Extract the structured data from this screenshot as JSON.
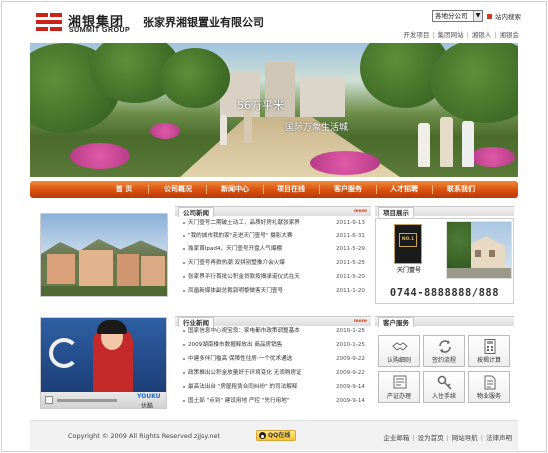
{
  "header": {
    "logo_cn": "湘银集团",
    "logo_en": "SUMMIT GROUP",
    "company_name": "张家界湘银置业有限公司",
    "branch_select": "各地分公司",
    "search_label": "站内搜索",
    "top_links": [
      "开发项目",
      "集团网站",
      "湘银人",
      "湘银会"
    ]
  },
  "banner": {
    "headline": "56万平米",
    "subline": "国际万象生活城"
  },
  "nav": {
    "items": [
      "首 页",
      "公司概况",
      "新闻中心",
      "项目在线",
      "客户服务",
      "人才招聘",
      "联系我们"
    ]
  },
  "company_news": {
    "title": "公司新闻",
    "more": "more",
    "items": [
      {
        "title": "天门壹号二期破土动工，品质好房礼献张家界",
        "date": "2011-9-13"
      },
      {
        "title": "\"我的城市我的家\"走进天门壹号\" 摄影大赛",
        "date": "2011-6-31"
      },
      {
        "title": "独家首Ipad4，天门壹号开盘人气爆棚",
        "date": "2011-5-29"
      },
      {
        "title": "天门壹号再掀热潮  双拼别墅推介会火爆",
        "date": "2011-5-25"
      },
      {
        "title": "张家界平行首批公积金贷款按揭承诺仪式在天",
        "date": "2011-5-20"
      },
      {
        "title": "凤凰新媒体副总裁郭明黎做客天门壹号",
        "date": "2011-1-20"
      }
    ]
  },
  "industry_news": {
    "title": "行业新闻",
    "more": "more",
    "items": [
      {
        "title": "国家信息中心祝宝良：家电都市政策调整基本",
        "date": "2010-1-25"
      },
      {
        "title": "2009湖南楼市数据释放出 商品房销售",
        "date": "2010-1-25"
      },
      {
        "title": "中建多伴门槛高 保障性住房·一个优术通选",
        "date": "2009-9-22"
      },
      {
        "title": "政策推出公积金放量好于环境变化 无须购房证",
        "date": "2009-9-22"
      },
      {
        "title": "最高法出台 \"房屋租赁合同纠纷\" 的司法解释",
        "date": "2009-9-14"
      },
      {
        "title": "国土部 \"点到\" 建设用地 严控 \"先行用地\"",
        "date": "2009-9-14"
      }
    ]
  },
  "video": {
    "brand_top": "YOUKU",
    "brand_cn": "优酷"
  },
  "project_display": {
    "title": "项目展示",
    "logo_no": "NO.1",
    "logo_name": "天门壹号",
    "tel": "0744-8888888/888"
  },
  "customer_service": {
    "title": "客户服务",
    "items": [
      {
        "label": "认购细则",
        "icon": "handshake-icon"
      },
      {
        "label": "签约流程",
        "icon": "cycle-icon"
      },
      {
        "label": "按揭计算",
        "icon": "calculator-icon"
      },
      {
        "label": "产证办理",
        "icon": "certificate-icon"
      },
      {
        "label": "入住手续",
        "icon": "key-icon"
      },
      {
        "label": "物业服务",
        "icon": "document-icon"
      }
    ]
  },
  "footer": {
    "copyright": "Copyright © 2009 All Rights Reserved zjjsy.net",
    "qq_label": "QQ在线",
    "links": [
      "企业邮箱",
      "设为首页",
      "网站导航",
      "法律声明"
    ]
  },
  "colors": {
    "brand_red": "#c8221a",
    "nav_orange": "#d94f10",
    "more_red": "#d03a1a"
  }
}
